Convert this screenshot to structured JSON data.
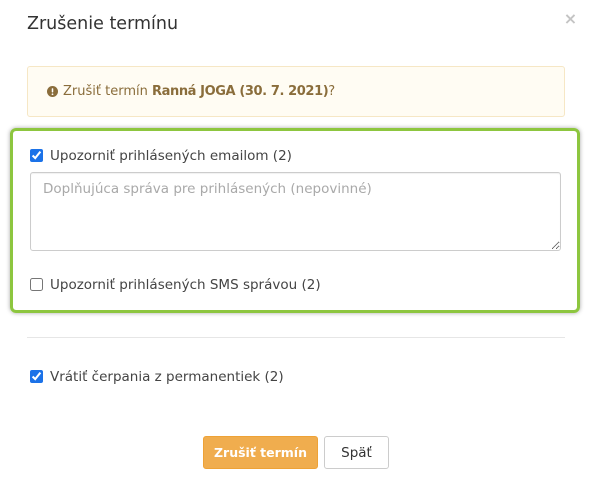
{
  "modal": {
    "title": "Zrušenie termínu",
    "close_glyph": "×"
  },
  "alert": {
    "icon": "exclamation-circle-icon",
    "prefix": "Zrušiť termín",
    "event": "Ranná JOGA (30. 7. 2021)",
    "suffix": "?"
  },
  "notify": {
    "email": {
      "label": "Upozorniť prihlásených emailom (2)",
      "checked": true
    },
    "message": {
      "value": "",
      "placeholder": "Doplňujúca správa pre prihlásených (nepovinné)"
    },
    "sms": {
      "label": "Upozorniť prihlásených SMS správou (2)",
      "checked": false
    }
  },
  "refund": {
    "label": "Vrátiť čerpania z permanentiek (2)",
    "checked": true
  },
  "actions": {
    "confirm_label": "Zrušiť termín",
    "back_label": "Späť"
  },
  "theme": {
    "highlight": "#8dc63f",
    "warning_text": "#8a6d3b",
    "warning_bg": "#fffcf3",
    "warning_border": "#f6e7c5",
    "primary_button": "#f0ad4e",
    "primary_button_border": "#eea236",
    "checkbox_accent": "#1b72e8"
  }
}
